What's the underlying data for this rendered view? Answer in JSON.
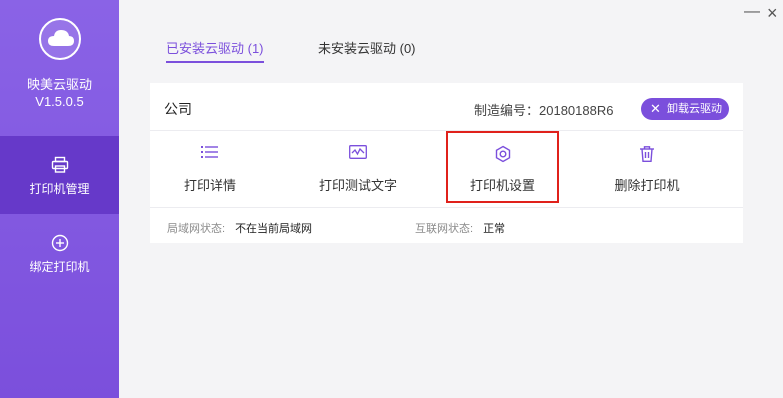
{
  "sidebar": {
    "app_name": "映美云驱动",
    "version": "V1.5.0.5",
    "items": [
      {
        "label": "打印机管理",
        "icon": "printer-icon",
        "active": true
      },
      {
        "label": "绑定打印机",
        "icon": "add-circle-icon",
        "active": false
      }
    ]
  },
  "window": {
    "minimize": "—",
    "close": "×"
  },
  "tabs": [
    {
      "label": "已安装云驱动 (1)",
      "active": true
    },
    {
      "label": "未安装云驱动 (0)",
      "active": false
    }
  ],
  "printer": {
    "name": "公司",
    "serial_label": "制造编号：",
    "serial": "20180188R6",
    "uninstall_label": "卸载云驱动",
    "actions": [
      {
        "label": "打印详情",
        "icon": "list-icon"
      },
      {
        "label": "打印测试文字",
        "icon": "test-print-icon"
      },
      {
        "label": "打印机设置",
        "icon": "gear-icon"
      },
      {
        "label": "删除打印机",
        "icon": "trash-icon"
      }
    ],
    "lan_status_label": "局域网状态:",
    "lan_status": "不在当前局域网",
    "internet_status_label": "互联网状态:",
    "internet_status": "正常"
  },
  "colors": {
    "accent": "#7b4fdc",
    "sidebar_active": "#6639c9",
    "highlight": "#e0211b"
  }
}
